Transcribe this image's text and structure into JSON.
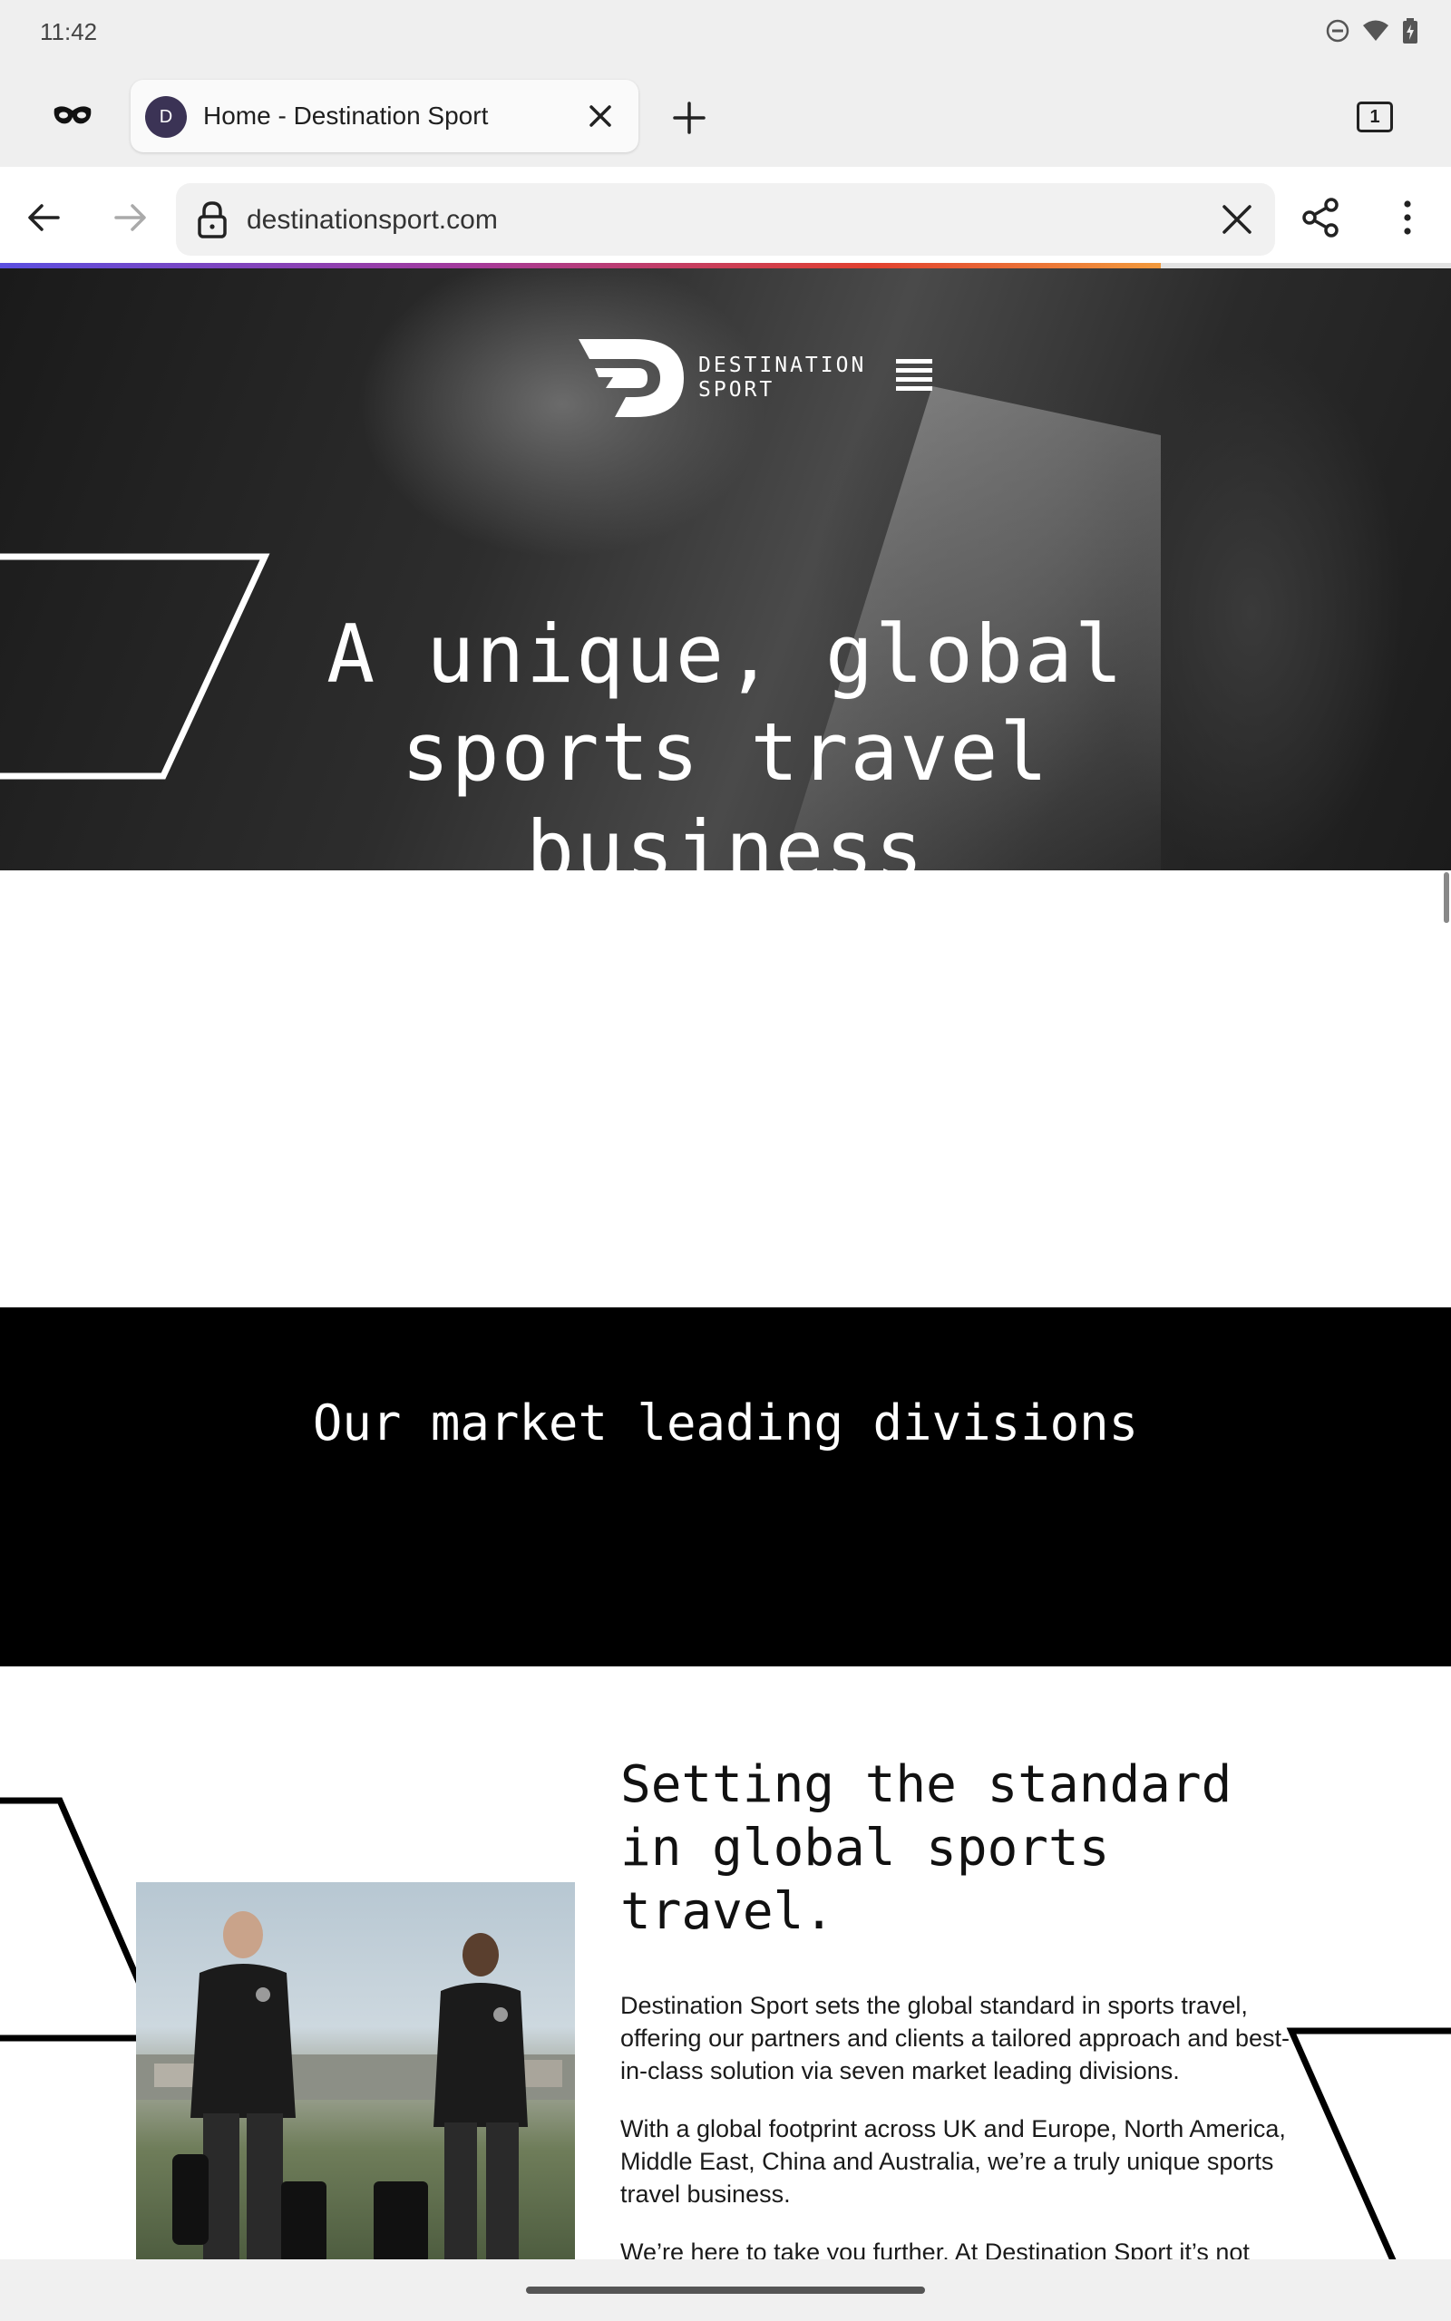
{
  "status_bar": {
    "time": "11:42",
    "icons": [
      "do-not-disturb-icon",
      "wifi-icon",
      "battery-charging-icon"
    ]
  },
  "browser": {
    "tab": {
      "favicon_letter": "D",
      "title": "Home - Destination Sport"
    },
    "tab_count": "1",
    "url": "destinationsport.com",
    "load_progress": 0.8
  },
  "site": {
    "brand": {
      "line1": "DESTINATION",
      "line2": "SPORT"
    },
    "hero": {
      "headline_line1": "A unique, global",
      "headline_line2": "sports travel",
      "headline_line3": "business"
    },
    "divisions": {
      "title": "Our market leading divisions"
    },
    "about": {
      "heading_line1": "Setting the standard",
      "heading_line2": "in global sports",
      "heading_line3": "travel.",
      "paragraph1": "Destination Sport sets the global standard in sports travel, offering our partners and clients a tailored approach and best-in-class solution via seven market leading divisions.",
      "paragraph2": "With a global footprint across UK and Europe, North America, Middle East, China and Australia, we’re a truly unique sports travel business.",
      "paragraph3": "We’re here to take you further. At Destination Sport it’s not"
    }
  },
  "colors": {
    "accent_gradient": [
      "#5b4fe0",
      "#a33a9c",
      "#e1402f",
      "#f29a3c"
    ],
    "band_background": "#000000"
  }
}
